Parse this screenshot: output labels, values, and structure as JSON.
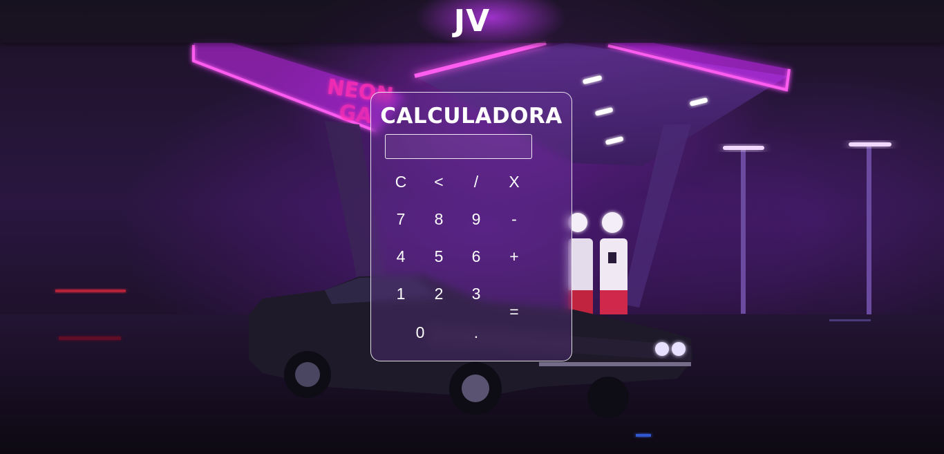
{
  "header": {
    "logo_text": "JV"
  },
  "calculator": {
    "title": "CALCULADORA",
    "display_value": "",
    "keys": {
      "clear": "C",
      "backspace": "<",
      "divide": "/",
      "multiply": "X",
      "seven": "7",
      "eight": "8",
      "nine": "9",
      "minus": "-",
      "four": "4",
      "five": "5",
      "six": "6",
      "plus": "+",
      "one": "1",
      "two": "2",
      "three": "3",
      "equals": "=",
      "zero": "0",
      "decimal": "."
    }
  },
  "background": {
    "sign_text": "NEON GA",
    "accent_color": "#c83cff",
    "neon_pink": "#ff3cd2"
  }
}
